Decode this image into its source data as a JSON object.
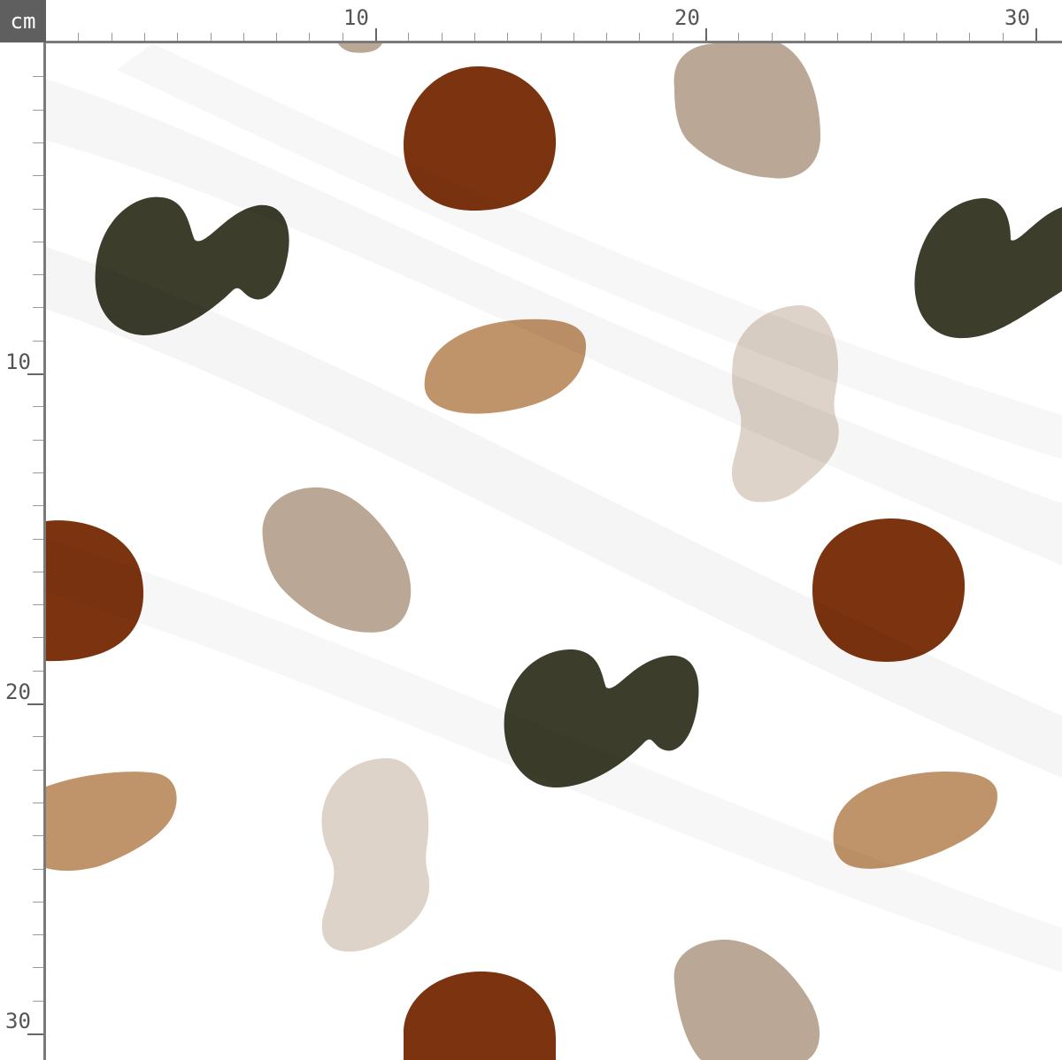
{
  "ruler": {
    "unit": "cm",
    "top_labels": [
      "10",
      "20",
      "30"
    ],
    "left_labels": [
      "10",
      "20",
      "30"
    ]
  },
  "colors": {
    "background": "#ffffff",
    "ruler_bar": "#5f5f5f",
    "rust": "#7c3410",
    "olive": "#3d3d2c",
    "sand": "#c0946a",
    "taupe": "#bba795",
    "cream": "#ddd3c8"
  }
}
